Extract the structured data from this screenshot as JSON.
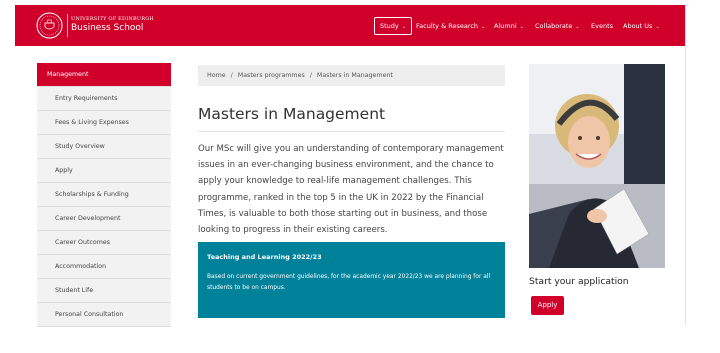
{
  "brand": {
    "university": "UNIVERSITY OF EDINBURGH",
    "school": "Business School",
    "logo_icon": "crest-seal-icon",
    "color": "#d1002a"
  },
  "nav": {
    "items": [
      {
        "label": "Study",
        "has_dropdown": true,
        "active": true
      },
      {
        "label": "Faculty & Research",
        "has_dropdown": true
      },
      {
        "label": "Alumni",
        "has_dropdown": true
      },
      {
        "label": "Collaborate",
        "has_dropdown": true
      },
      {
        "label": "Events",
        "has_dropdown": false
      },
      {
        "label": "About Us",
        "has_dropdown": true
      }
    ],
    "chevron_icon": "chevron-down-icon"
  },
  "sidebar": {
    "items": [
      {
        "label": "Management",
        "active": true
      },
      {
        "label": "Entry Requirements"
      },
      {
        "label": "Fees & Living Expenses"
      },
      {
        "label": "Study Overview"
      },
      {
        "label": "Apply"
      },
      {
        "label": "Scholarships & Funding"
      },
      {
        "label": "Career Development"
      },
      {
        "label": "Career Outcomes"
      },
      {
        "label": "Accommodation"
      },
      {
        "label": "Student Life"
      },
      {
        "label": "Personal Consultation"
      }
    ]
  },
  "breadcrumb": {
    "items": [
      "Home",
      "Masters programmes",
      "Masters in Management"
    ],
    "separator": "/"
  },
  "main": {
    "title": "Masters in Management",
    "intro": "Our MSc will give you an understanding of contemporary management issues in an ever-changing business environment, and the chance to apply your knowledge to real-life management challenges. This programme, ranked in the top 5 in the UK in 2022 by the Financial Times, is valuable to both those starting out in business, and those looking to progress in their existing careers.",
    "notice": {
      "title": "Teaching and Learning 2022/23",
      "text": "Based on current government guidelines, for the academic year 2022/23 we are planning for all students to be on campus.",
      "color": "#00819a"
    }
  },
  "aside": {
    "photo_alt": "smiling-student-photo",
    "cta_heading": "Start your application",
    "apply_label": "Apply"
  }
}
